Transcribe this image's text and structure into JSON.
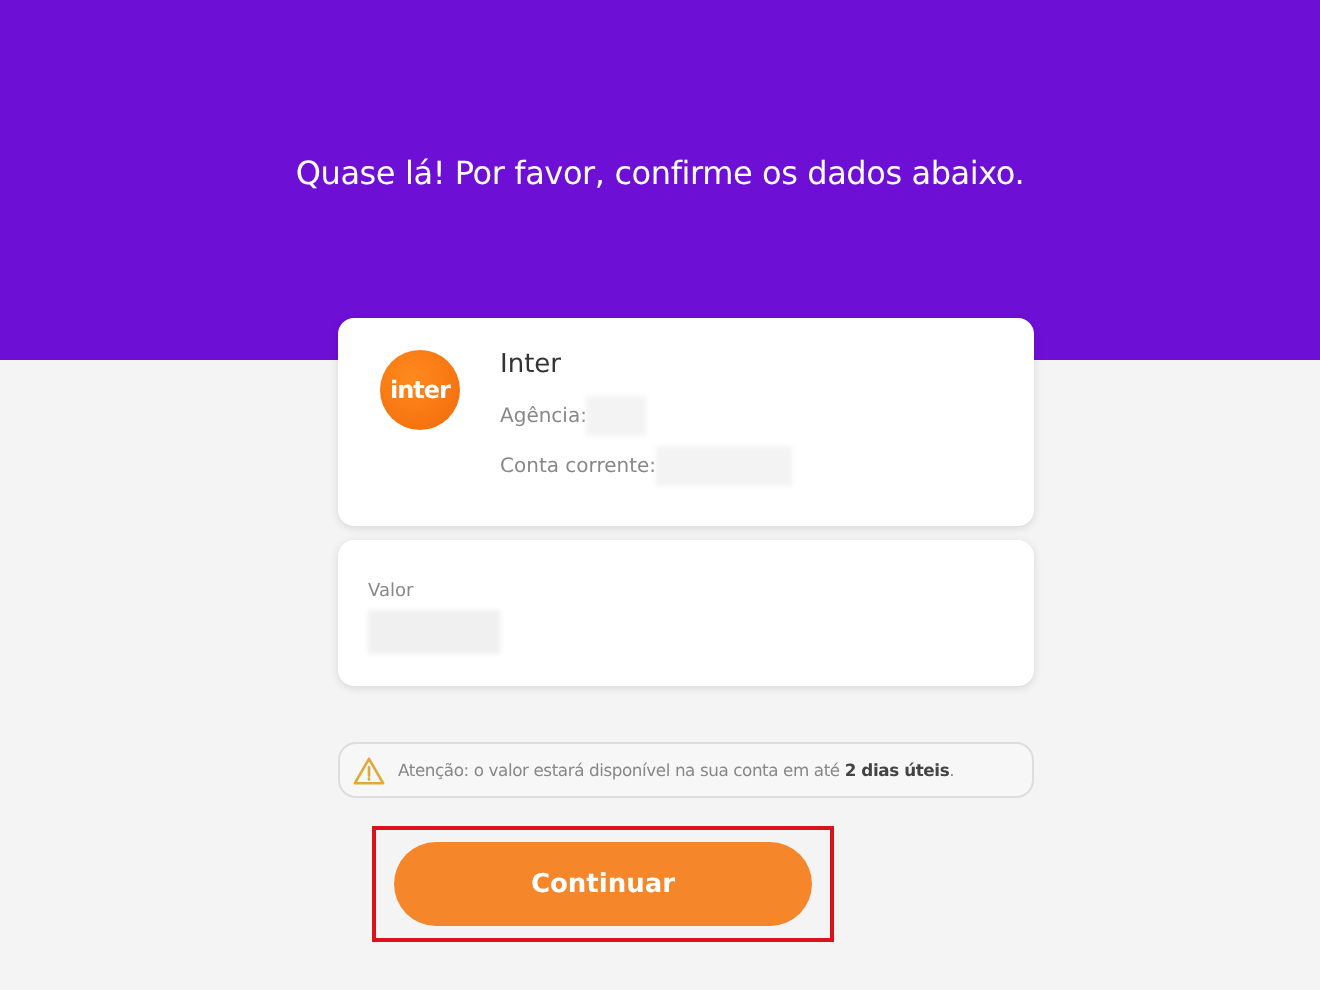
{
  "header": {
    "title": "Quase lá! Por favor, confirme os dados abaixo."
  },
  "account": {
    "logo_text": "inter",
    "bank": "Inter",
    "fields": [
      {
        "label": "Agência:"
      },
      {
        "label": "Conta corrente:"
      }
    ]
  },
  "amount": {
    "label": "Valor"
  },
  "notice": {
    "text": "Atenção: o valor estará disponível na sua conta em até **2 dias úteis**."
  },
  "button": {
    "label": "Continuar",
    "highlighted": true
  }
}
